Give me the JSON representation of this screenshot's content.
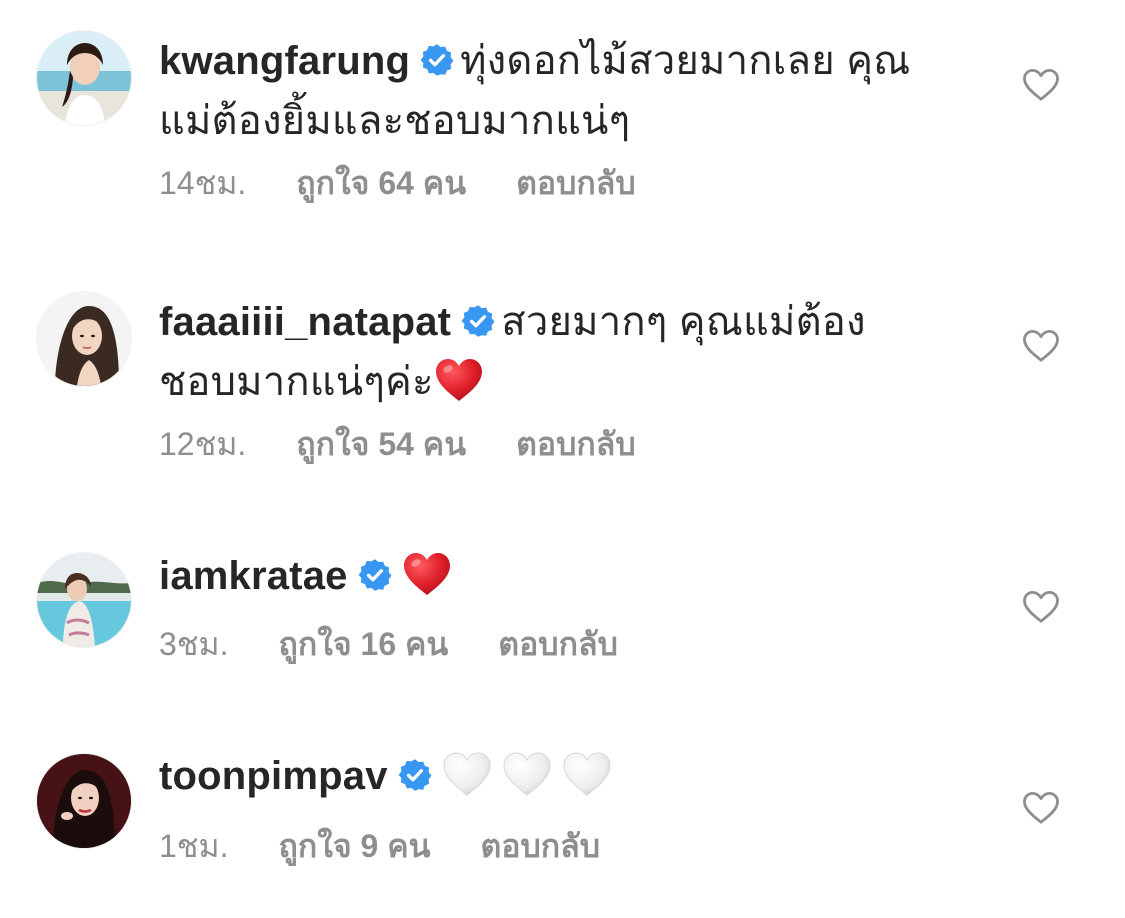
{
  "comments": [
    {
      "username": "kwangfarung",
      "verified": true,
      "text_line1": "ทุ่งดอกไม้สวยมากเลย คุณ",
      "text_line2": "แม่ต้องยิ้มและชอบมากแน่ๆ",
      "time": "14ชม.",
      "likes": "ถูกใจ 64 คน",
      "reply": "ตอบกลับ",
      "emoji": []
    },
    {
      "username": "faaaiiii_natapat",
      "verified": true,
      "text_line1": "สวยมากๆ คุณแม่ต้อง",
      "text_line2": "ชอบมากแน่ๆค่ะ",
      "time": "12ชม.",
      "likes": "ถูกใจ 54 คน",
      "reply": "ตอบกลับ",
      "emoji": [
        "red-heart"
      ]
    },
    {
      "username": "iamkratae",
      "verified": true,
      "text_line1": "",
      "text_line2": "",
      "time": "3ชม.",
      "likes": "ถูกใจ 16 คน",
      "reply": "ตอบกลับ",
      "emoji": [
        "red-heart"
      ]
    },
    {
      "username": "toonpimpav",
      "verified": true,
      "text_line1": "",
      "text_line2": "",
      "time": "1ชม.",
      "likes": "ถูกใจ 9 คน",
      "reply": "ตอบกลับ",
      "emoji": [
        "white-heart",
        "white-heart",
        "white-heart"
      ]
    }
  ],
  "icons": {
    "verified": "verified-badge-icon",
    "like": "heart-outline-icon"
  },
  "colors": {
    "verified_blue": "#3897f0",
    "meta_gray": "#8e8e8e",
    "text": "#262626",
    "heart_outline": "#8e8e8e",
    "red_heart": "#e0202b",
    "white_heart": "#e9e9e9"
  }
}
